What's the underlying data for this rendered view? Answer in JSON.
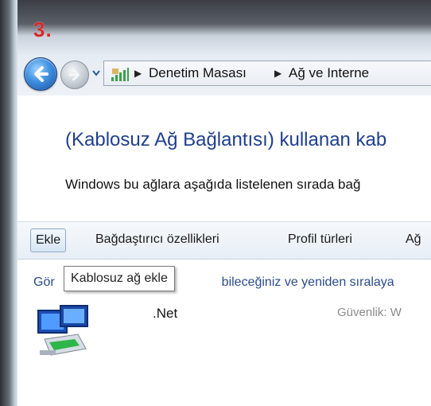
{
  "step_marker": "3.",
  "nav": {
    "breadcrumbs": [
      "Denetim Masası",
      "Ağ ve Interne"
    ],
    "address_icon": "network-signal-icon"
  },
  "heading": "(Kablosuz Ağ Bağlantısı) kullanan kab",
  "description": "Windows bu ağlara aşağıda listelenen sırada bağ",
  "toolbar": {
    "add": "Ekle",
    "adapter_props": "Bağdaştırıcı özellikleri",
    "profile_types": "Profil türleri",
    "network": "Ağ"
  },
  "list_caption": {
    "prefix": "Gör",
    "suffix": "bileceğiniz ve yeniden sıralaya"
  },
  "tooltip": "Kablosuz ağ ekle",
  "network_item": {
    "name": ".Net",
    "security_label": "Güvenlik:",
    "security_value": "W"
  },
  "colors": {
    "step": "#d8262b",
    "heading": "#1f3f8f",
    "caption": "#2a4a8c"
  }
}
